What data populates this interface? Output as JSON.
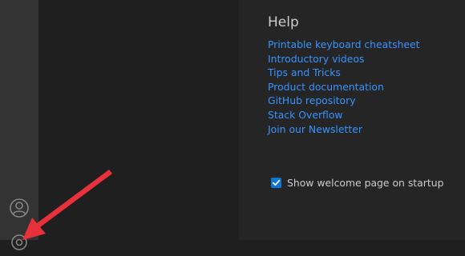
{
  "help": {
    "title": "Help",
    "links": [
      "Printable keyboard cheatsheet",
      "Introductory videos",
      "Tips and Tricks",
      "Product documentation",
      "GitHub repository",
      "Stack Overflow",
      "Join our Newsletter"
    ]
  },
  "startup": {
    "label": "Show welcome page on startup",
    "checked": true
  },
  "activity_bar": {
    "icons": [
      "account-icon",
      "manage-icon"
    ]
  },
  "colors": {
    "link": "#3794ff",
    "annotation_arrow": "#e8313a",
    "checkbox": "#0e75d0"
  }
}
